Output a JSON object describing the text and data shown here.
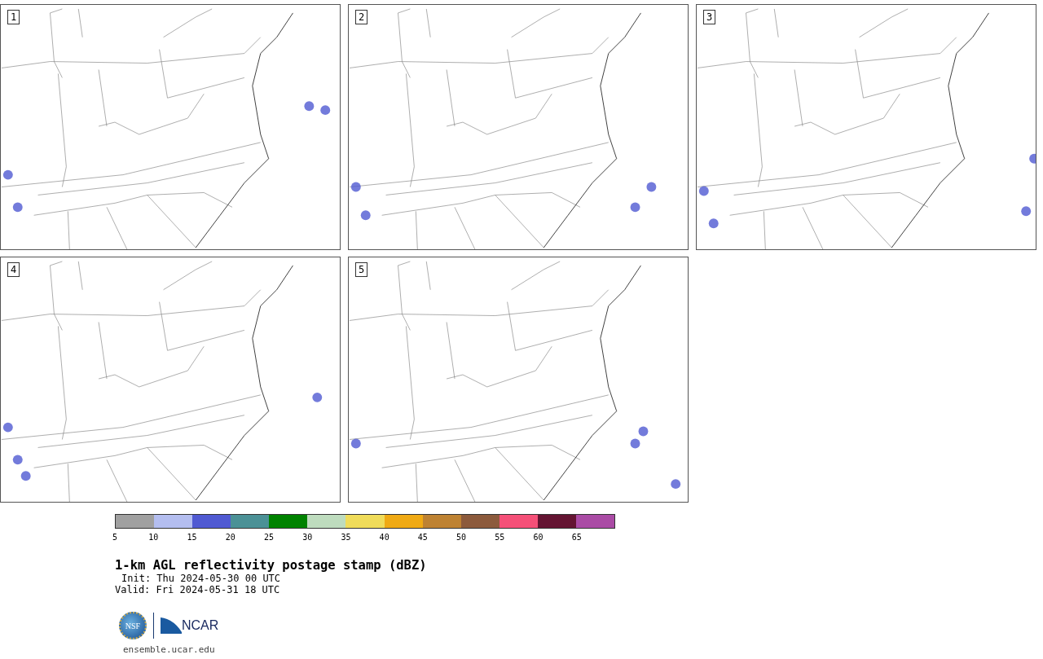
{
  "panels": [
    {
      "label": "1"
    },
    {
      "label": "2"
    },
    {
      "label": "3"
    },
    {
      "label": "4"
    },
    {
      "label": "5"
    }
  ],
  "colorbar": {
    "segments": [
      {
        "color": "#a0a0a0"
      },
      {
        "color": "#b4bef0"
      },
      {
        "color": "#505ad2"
      },
      {
        "color": "#4b9196"
      },
      {
        "color": "#008200"
      },
      {
        "color": "#bedcbe"
      },
      {
        "color": "#f0dc5a"
      },
      {
        "color": "#f0aa14"
      },
      {
        "color": "#be8232"
      },
      {
        "color": "#8c5a3c"
      },
      {
        "color": "#f55078"
      },
      {
        "color": "#641432"
      },
      {
        "color": "#aa4ba5"
      }
    ],
    "ticks": [
      "5",
      "10",
      "15",
      "20",
      "25",
      "30",
      "35",
      "40",
      "45",
      "50",
      "55",
      "60",
      "65"
    ]
  },
  "title": "1-km AGL reflectivity postage stamp (dBZ)",
  "init": "Init: Thu 2024-05-30 00 UTC",
  "valid": "Valid: Fri 2024-05-31 18 UTC",
  "logos": {
    "nsf": "NSF",
    "ncar": "NCAR"
  },
  "link": "ensemble.ucar.edu"
}
